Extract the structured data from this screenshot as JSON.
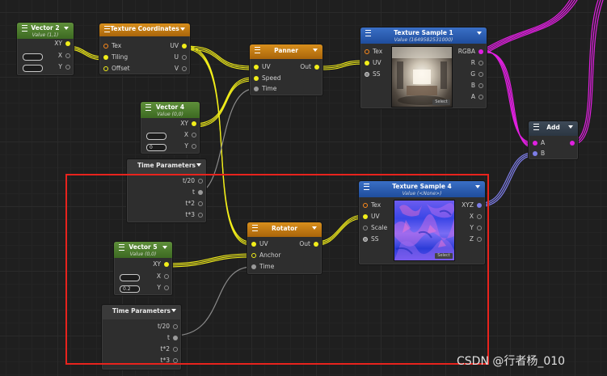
{
  "nodes": {
    "vector2": {
      "title": "Vector 2",
      "subtitle": "Value (1,1)",
      "out_label": "XY",
      "x_label": "X",
      "y_label": "Y",
      "x_value": "",
      "y_value": ""
    },
    "texcoord": {
      "title": "Texture Coordinates",
      "in_tex": "Tex",
      "in_tiling": "Tiling",
      "in_offset": "Offset",
      "out_uv": "UV",
      "out_u": "U",
      "out_v": "V"
    },
    "panner": {
      "title": "Panner",
      "in_uv": "UV",
      "in_speed": "Speed",
      "in_time": "Time",
      "out": "Out"
    },
    "texsample1": {
      "title": "Texture Sample 1",
      "subtitle": "Value (1649582531000)",
      "in_tex": "Tex",
      "in_uv": "UV",
      "in_ss": "SS",
      "out_rgba": "RGBA",
      "out_r": "R",
      "out_g": "G",
      "out_b": "B",
      "out_a": "A",
      "select_label": "Select"
    },
    "vector4": {
      "title": "Vector 4",
      "subtitle": "Value (0,0)",
      "out_label": "XY",
      "x_label": "X",
      "y_label": "Y",
      "x_value": "",
      "y_value": "0"
    },
    "add": {
      "title": "Add",
      "in_a": "A",
      "in_b": "B"
    },
    "timeparams1": {
      "title": "Time Parameters",
      "out_t20": "t/20",
      "out_t": "t",
      "out_t2": "t*2",
      "out_t3": "t*3"
    },
    "texsample4": {
      "title": "Texture Sample 4",
      "subtitle": "Value (<None>)",
      "in_tex": "Tex",
      "in_uv": "UV",
      "in_scale": "Scale",
      "in_ss": "SS",
      "out_xyz": "XYZ",
      "out_x": "X",
      "out_y": "Y",
      "out_z": "Z",
      "select_label": "Select"
    },
    "rotator": {
      "title": "Rotator",
      "in_uv": "UV",
      "in_anchor": "Anchor",
      "in_time": "Time",
      "out": "Out"
    },
    "vector5": {
      "title": "Vector 5",
      "subtitle": "Value (0,0)",
      "out_label": "XY",
      "x_label": "X",
      "y_label": "Y",
      "x_value": "",
      "y_value": "0.2"
    },
    "timeparams2": {
      "title": "Time Parameters",
      "out_t20": "t/20",
      "out_t": "t",
      "out_t2": "t*2",
      "out_t3": "t*3"
    }
  },
  "watermark": "CSDN @行者杨_010",
  "colors": {
    "float2_wire": "#f2ee1a",
    "float_wire": "#9a9a9a",
    "rgba_wire": "#e020e0",
    "xyz_wire": "#7e7ee8",
    "selection": "#e8231d"
  }
}
